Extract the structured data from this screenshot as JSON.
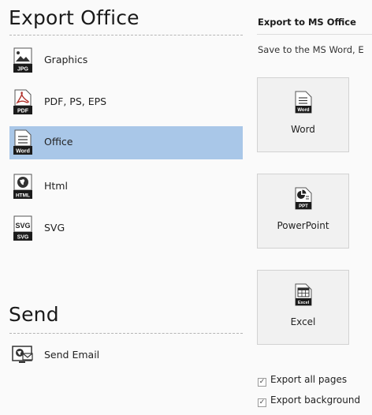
{
  "export_section": {
    "title": "Export Office",
    "items": [
      {
        "label": "Graphics",
        "icon": "jpg-file-icon",
        "tag": "JPG",
        "selected": false
      },
      {
        "label": "PDF, PS, EPS",
        "icon": "pdf-file-icon",
        "tag": "PDF",
        "selected": false
      },
      {
        "label": "Office",
        "icon": "word-file-icon",
        "tag": "Word",
        "selected": true
      },
      {
        "label": "Html",
        "icon": "html-file-icon",
        "tag": "HTML",
        "selected": false
      },
      {
        "label": "SVG",
        "icon": "svg-file-icon",
        "tag": "SVG",
        "selected": false
      }
    ]
  },
  "send_section": {
    "title": "Send",
    "items": [
      {
        "label": "Send Email",
        "icon": "send-email-icon"
      }
    ]
  },
  "detail": {
    "header": "Export to MS Office",
    "description": "Save to the MS Word, E",
    "buttons": [
      {
        "label": "Word",
        "icon": "word-doc-icon",
        "tag": "Word"
      },
      {
        "label": "PowerPoint",
        "icon": "ppt-doc-icon",
        "tag": "PPT"
      },
      {
        "label": "Excel",
        "icon": "excel-doc-icon",
        "tag": "Excel"
      }
    ],
    "options": [
      {
        "label": "Export all pages",
        "checked": true
      },
      {
        "label": "Export background",
        "checked": true
      }
    ]
  },
  "colors": {
    "selected_bg": "#a9c7e8",
    "panel_bg": "#fafafa",
    "icon_tag": "#1b1b1b"
  }
}
